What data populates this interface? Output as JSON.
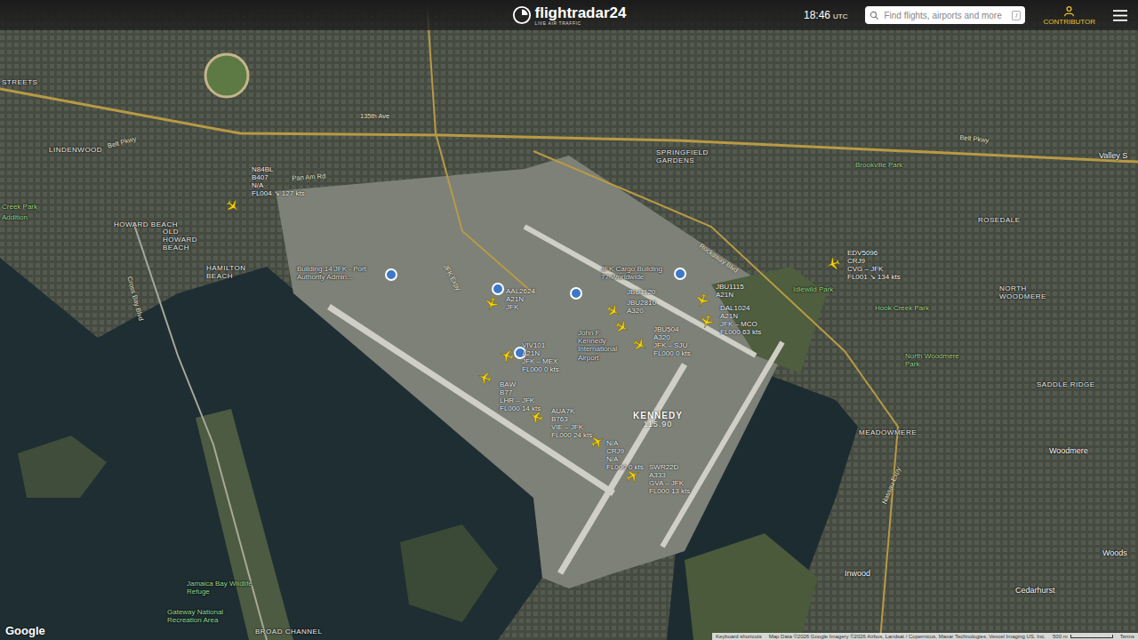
{
  "header": {
    "logo": "flightradar24",
    "tagline": "LIVE AIR TRAFFIC",
    "time": "18:46",
    "timezone": "UTC",
    "search": {
      "placeholder": "Find flights, airports and more",
      "shortcut": "/"
    },
    "contributor": "CONTRIBUTOR"
  },
  "flights": [
    {
      "callsign": "N84BL",
      "aircraft": "B407",
      "route": "N/A",
      "status": "FL004 ↘ 127 kts"
    },
    {
      "callsign": "EDV5096",
      "aircraft": "CRJ9",
      "route": "CVG – JFK",
      "status": "FL001 ↘ 134 kts"
    },
    {
      "callsign": "AAL2624",
      "aircraft": "A21N",
      "route": "JFK",
      "status": ""
    },
    {
      "callsign": "VIV101",
      "aircraft": "A21N",
      "route": "JFK – MEX",
      "status": "FL000 0 kts"
    },
    {
      "callsign": "BAW",
      "aircraft": "B77",
      "route": "LHR – JFK",
      "status": "FL000 14 kts"
    },
    {
      "callsign": "AUA7K",
      "aircraft": "B763",
      "route": "VIE – JFK",
      "status": "FL000 24 kts"
    },
    {
      "callsign": "N/A",
      "aircraft": "CRJ9",
      "route": "N/A",
      "status": "FL000 0 kts"
    },
    {
      "callsign": "SWR22D",
      "aircraft": "A333",
      "route": "GVA – JFK",
      "status": "FL000 13 kts"
    },
    {
      "callsign": "JBU1120",
      "aircraft": "",
      "route": "",
      "status": ""
    },
    {
      "callsign": "JBU2810",
      "aircraft": "A320",
      "route": "",
      "status": ""
    },
    {
      "callsign": "JBU504",
      "aircraft": "A320",
      "route": "JFK – SJU",
      "status": "FL000 0 kts"
    },
    {
      "callsign": "JBU1115",
      "aircraft": "A21N",
      "route": "",
      "status": ""
    },
    {
      "callsign": "DAL1024",
      "aircraft": "A21N",
      "route": "JFK – MCO",
      "status": "FL000 63 kts"
    }
  ],
  "navaid": {
    "name": "KENNEDY",
    "frequency": "115.90"
  },
  "places": [
    {
      "name": "STREETS",
      "kind": "district"
    },
    {
      "name": "LINDENWOOD",
      "kind": "district"
    },
    {
      "name": "HOWARD BEACH",
      "kind": "district"
    },
    {
      "name": "OLD HOWARD BEACH",
      "kind": "district"
    },
    {
      "name": "HAMILTON BEACH",
      "kind": "district"
    },
    {
      "name": "SPRINGFIELD GARDENS",
      "kind": "district"
    },
    {
      "name": "ROSEDALE",
      "kind": "district"
    },
    {
      "name": "NORTH WOODMERE",
      "kind": "district"
    },
    {
      "name": "SADDLE RIDGE",
      "kind": "district"
    },
    {
      "name": "MEADOWMERE",
      "kind": "district"
    },
    {
      "name": "BROAD CHANNEL",
      "kind": "district"
    },
    {
      "name": "Woodmere",
      "kind": "town"
    },
    {
      "name": "Inwood",
      "kind": "town"
    },
    {
      "name": "Cedarhurst",
      "kind": "town"
    },
    {
      "name": "Valley S",
      "kind": "town"
    },
    {
      "name": "Woods",
      "kind": "town"
    },
    {
      "name": "Creek Park",
      "kind": "park"
    },
    {
      "name": "Addition",
      "kind": "park"
    },
    {
      "name": "Idlewild Park",
      "kind": "park"
    },
    {
      "name": "Brookville Park",
      "kind": "park"
    },
    {
      "name": "Hook Creek Park",
      "kind": "park"
    },
    {
      "name": "North Woodmere Park",
      "kind": "park"
    },
    {
      "name": "Jamaica Bay Wildlife Refuge",
      "kind": "park"
    },
    {
      "name": "Gateway National Recreation Area",
      "kind": "park"
    },
    {
      "name": "John F. Kennedy International Airport",
      "kind": "poi"
    },
    {
      "name": "Building 14 JFK - Port Authority Admin...",
      "kind": "poi"
    },
    {
      "name": "JFK Cargo Building 77 Worldwide",
      "kind": "poi"
    }
  ],
  "roads": [
    "Belt Pkwy",
    "Belt Pkwy",
    "Rockaway Blvd",
    "Cross Bay Blvd",
    "Nassau Expy",
    "135th Ave",
    "Pan Am Rd",
    "JFK Expy"
  ],
  "footer": {
    "logo": "Google",
    "shortcuts": "Keyboard shortcuts",
    "attribution": "Map Data ©2026 Google Imagery ©2026 Airbus, Landsat / Copernicus, Maxar Technologies, Vexcel Imaging US, Inc.",
    "scale": "500 m",
    "terms": "Terms"
  }
}
